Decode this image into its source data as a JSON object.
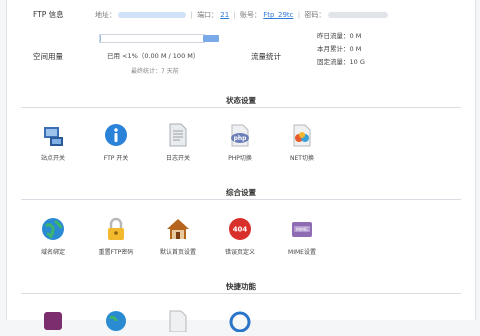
{
  "ftp": {
    "label": "FTP 信息",
    "addr_label": "地址：",
    "port_label": "端口：",
    "port_value": "21",
    "account_label": "账号：",
    "account_value": "Ftp_29tc",
    "password_label": "密码："
  },
  "space": {
    "label": "空间用量",
    "usage_text": "已用 <1%（0.00 M / 100 M）",
    "note": "最终统计：7 天前",
    "usage_fraction": 0.01
  },
  "traffic": {
    "label": "流量统计",
    "today": "昨日流量：0 M",
    "month": "本月累计：0 M",
    "limit": "固定流量：10 G"
  },
  "sections": [
    {
      "title": "状态设置",
      "items": [
        {
          "icon": "site-switch-icon",
          "label": "站点开关"
        },
        {
          "icon": "ftp-info-icon",
          "label": "FTP 开关"
        },
        {
          "icon": "log-file-icon",
          "label": "日志开关"
        },
        {
          "icon": "php-icon",
          "label": "PHP切换"
        },
        {
          "icon": "net-icon",
          "label": "NET切换"
        }
      ]
    },
    {
      "title": "综合设置",
      "items": [
        {
          "icon": "globe-icon",
          "label": "域名绑定"
        },
        {
          "icon": "lock-icon",
          "label": "重置FTP密码"
        },
        {
          "icon": "home-icon",
          "label": "默认首页设置"
        },
        {
          "icon": "error-404-icon",
          "label": "错误页定义"
        },
        {
          "icon": "mime-icon",
          "label": "MIME设置"
        }
      ]
    },
    {
      "title": "快捷功能",
      "items": [
        {
          "icon": "shortcut-1-icon",
          "label": ""
        },
        {
          "icon": "shortcut-2-icon",
          "label": ""
        },
        {
          "icon": "shortcut-3-icon",
          "label": ""
        },
        {
          "icon": "shortcut-4-icon",
          "label": ""
        }
      ]
    }
  ]
}
